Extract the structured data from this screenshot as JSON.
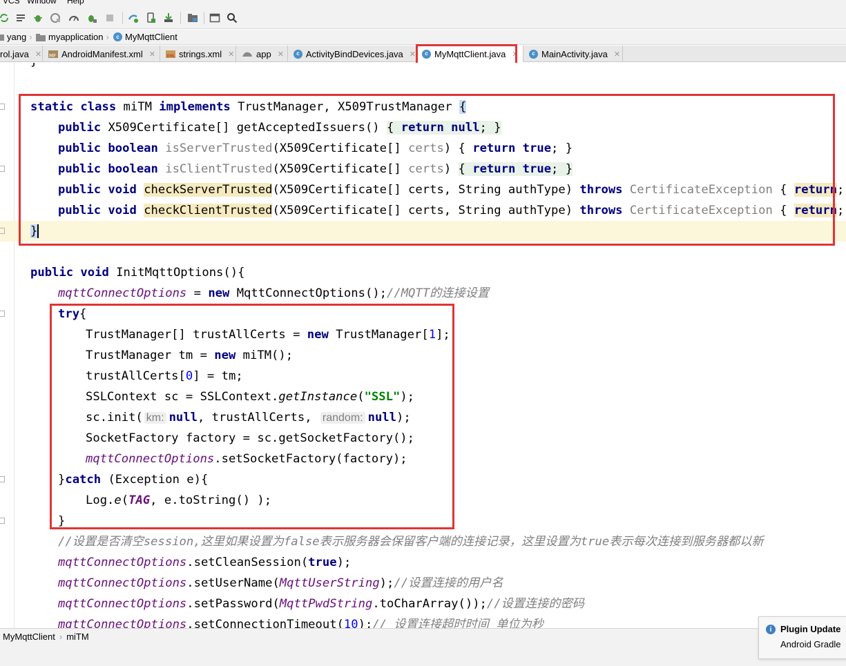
{
  "menu": {
    "items": [
      "VCS",
      "Window",
      "Help"
    ]
  },
  "toolbar": {
    "icons": [
      "sync-icon",
      "list-icon",
      "debug-bug-icon",
      "profile-icon",
      "gauge-icon",
      "attach-debugger-icon",
      "stop-icon",
      "gradle-sync-icon",
      "device-icon",
      "sdk-download-icon",
      "project-structure-icon",
      "layout-icon",
      "search-icon"
    ]
  },
  "breadcrumb": {
    "items": [
      "yang",
      "myapplication",
      "MyMqttClient"
    ]
  },
  "tabs": [
    {
      "label": "rol.java",
      "icon": "java-file-icon"
    },
    {
      "label": "AndroidManifest.xml",
      "icon": "manifest-file-icon"
    },
    {
      "label": "strings.xml",
      "icon": "xml-file-icon"
    },
    {
      "label": "app",
      "icon": "gradle-icon"
    },
    {
      "label": "ActivityBindDevices.java",
      "icon": "class-icon"
    },
    {
      "label": "MyMqttClient.java",
      "icon": "class-icon",
      "active": true
    },
    {
      "label": "MainActivity.java",
      "icon": "class-icon"
    }
  ],
  "code": {
    "line0": "}",
    "class_decl": {
      "kw1": "static class",
      "name": " miTM ",
      "kw2": "implements",
      "rest": " TrustManager, X509TrustManager ",
      "brace": "{"
    },
    "m1": {
      "kw": "public",
      "sig": " X509Certificate[] getAcceptedIssuers() ",
      "ob": "{ ",
      "ret": "return null",
      "tail": "; }"
    },
    "m2": {
      "kw": "public boolean",
      "name": "isServerTrusted",
      "params1": "(X509Certificate[] ",
      "param": "certs",
      "params2": ") { ",
      "ret": "return true",
      "tail": "; }"
    },
    "m3": {
      "kw": "public boolean",
      "name": "isClientTrusted",
      "params1": "(X509Certificate[] ",
      "param": "certs",
      "params2": ") ",
      "ob": "{ ",
      "ret": "return true",
      "tail": "; }"
    },
    "m4": {
      "kw": "public void",
      "name": "checkServerTrusted",
      "params": "(X509Certificate[] certs, String authType) ",
      "throws": "throws",
      "exc": " CertificateException ",
      "ob": "{ ",
      "ret": "return",
      "tail": "; }"
    },
    "m5": {
      "kw": "public void",
      "name": "checkClientTrusted",
      "params": "(X509Certificate[] certs, String authType) ",
      "throws": "throws",
      "exc": " CertificateException ",
      "ob": "{ ",
      "ret": "return",
      "tail": "; }"
    },
    "class_close": "}",
    "init_decl": {
      "kw": "public void",
      "rest": " InitMqttOptions(){"
    },
    "opts_new": {
      "field": "mqttConnectOptions",
      "eq": " = ",
      "kw": "new",
      "rest": " MqttConnectOptions();",
      "comment": "//MQTT的连接设置"
    },
    "try": {
      "kw": "try",
      "rest": "{"
    },
    "t1": {
      "pre": "TrustManager[] trustAllCerts = ",
      "kw": "new",
      "mid": " TrustManager[",
      "num": "1",
      "end": "];"
    },
    "t2": {
      "pre": "TrustManager tm = ",
      "kw": "new",
      "end": " miTM();"
    },
    "t3": {
      "pre": "trustAllCerts[",
      "num": "0",
      "end": "] = tm;"
    },
    "t4": {
      "pre": "SSLContext sc = SSLContext.",
      "method": "getInstance",
      "open": "(",
      "str": "\"SSL\"",
      "end": ");"
    },
    "t5": {
      "pre": "sc.init(",
      "hint1": "km:",
      "null1": "null",
      "mid": ", trustAllCerts, ",
      "hint2": "random:",
      "null2": "null",
      "end": ");"
    },
    "t6": "SocketFactory factory = sc.getSocketFactory();",
    "t7": {
      "field": "mqttConnectOptions",
      "end": ".setSocketFactory(factory);"
    },
    "catch": {
      "pre": "}",
      "kw": "catch",
      "end": " (Exception e){"
    },
    "c1": {
      "pre": "Log.",
      "method": "e",
      "open": "(",
      "tag": "TAG",
      "end": ", e.toString() );"
    },
    "close_try": "}",
    "comment_long": "//设置是否清空session,这里如果设置为false表示服务器会保留客户端的连接记录，这里设置为true表示每次连接到服务器都以新",
    "s1": {
      "field": "mqttConnectOptions",
      "mid": ".setCleanSession(",
      "kw": "true",
      "end": ");"
    },
    "s2": {
      "field": "mqttConnectOptions",
      "mid": ".setUserName(",
      "arg": "MqttUserString",
      "end": ");",
      "comment": "//设置连接的用户名"
    },
    "s3": {
      "field": "mqttConnectOptions",
      "mid": ".setPassword(",
      "arg": "MqttPwdString",
      "end": ".toCharArray());",
      "comment": "//设置连接的密码"
    },
    "s4": {
      "field": "mqttConnectOptions",
      "mid": ".setConnectionTimeout(",
      "num": "10",
      "end": ");",
      "comment": "// 设置连接超时时间 单位为秒"
    }
  },
  "status": {
    "crumbs": [
      "MyMqttClient",
      "miTM"
    ]
  },
  "notification": {
    "title": "Plugin Update",
    "body": "Android Gradle"
  },
  "colors": {
    "keyword": "#000080",
    "string": "#008000",
    "field": "#660e7a",
    "comment": "#808080",
    "highlight_box": "#e03535"
  }
}
